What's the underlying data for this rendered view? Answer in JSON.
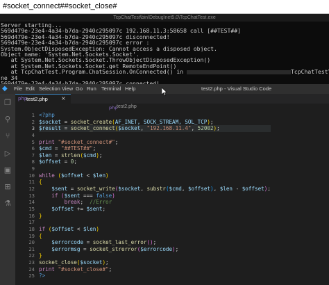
{
  "topbar": {
    "text": "#socket_connect##socket_close#"
  },
  "console": {
    "title": "TcpChatTest\\bin\\Debug\\net5.0\\TcpChatTest.exe",
    "lines": [
      "Server starting...",
      "569d479e-23e4-4a34-b7da-2940c295097c 192.168.11.3:58658 call [##TEST##]",
      "569d479e-23e4-4a34-b7da-2940c295097c disconnected!",
      "569d479e-23e4-4a34-b7da-2940c295097c error :",
      "System.ObjectDisposedException: Cannot access a disposed object.",
      "Object name: 'System.Net.Sockets.Socket'.",
      "   at System.Net.Sockets.Socket.ThrowObjectDisposedException()",
      "   at System.Net.Sockets.Socket.get_RemoteEndPoint()",
      "   at TcpChatTest.Program.ChatSession.OnConnected() in "
    ],
    "path_tail": "TcpChatTest\\Program.cs:li",
    "after_lines": [
      "ne 34",
      "569d479e-23e4-4a34-b7da-2940c295097c connected!"
    ]
  },
  "vscode": {
    "menu": [
      "File",
      "Edit",
      "Selection",
      "View",
      "Go",
      "Run",
      "Terminal",
      "Help"
    ],
    "window_title": "test2.php - Visual Studio Code",
    "tab": {
      "label": "test2.php",
      "close": "×"
    },
    "breadcrumb": "test2.php",
    "php_icon": "php",
    "line_numbers": [
      "1",
      "2",
      "3",
      "4",
      "5",
      "6",
      "7",
      "8",
      "9",
      "10",
      "11",
      "12",
      "13",
      "14",
      "15",
      "16",
      "17",
      "18",
      "19",
      "20",
      "21",
      "22",
      "23",
      "24",
      "25"
    ],
    "activity_icons": [
      "files-icon",
      "search-icon",
      "source-control-icon",
      "run-debug-icon",
      "remote-explorer-icon",
      "extensions-icon",
      "testing-icon"
    ]
  },
  "code": {
    "l1": "<?php",
    "l2_var": "$socket",
    "l2_fn": "socket_create",
    "l2_args": "AF_INET, SOCK_STREAM, SOL_TCP",
    "l3_var": "$result",
    "l3_fn": "socket_connect",
    "l3_arg1": "$socket",
    "l3_str": "\"192.168.11.4\"",
    "l3_num": "52002",
    "l5_kw": "print",
    "l5_str": "\"#socket_connect#\"",
    "l6_var": "$cmd",
    "l6_str": "\"##TEST##\"",
    "l7_var": "$len",
    "l7_fn": "strlen",
    "l7_arg": "$cmd",
    "l8_var": "$offset",
    "l8_num": "0",
    "l10_kw": "while",
    "l10_a": "$offset",
    "l10_b": "$len",
    "l11": "{",
    "l12_var": "$sent",
    "l12_fn": "socket_write",
    "l12_a": "$socket",
    "l12_fn2": "substr",
    "l12_b": "$cmd",
    "l12_c": "$offset",
    "l12_d": "$len",
    "l12_e": "$offset",
    "l13_kw": "if",
    "l13_var": "$sent",
    "l13_c": "false",
    "l14_kw": "break",
    "l14_cm": "//Error",
    "l15_var": "$offset",
    "l15_b": "$sent",
    "l16": "}",
    "l18_kw": "if",
    "l18_a": "$offset",
    "l18_b": "$len",
    "l19": "{",
    "l20_var": "$errorcode",
    "l20_fn": "socket_last_error",
    "l21_var": "$errormsg",
    "l21_fn": "socket_strerror",
    "l21_arg": "$errorcode",
    "l22": "}",
    "l23_fn": "socket_close",
    "l23_arg": "$socket",
    "l24_kw": "print",
    "l24_str": "\"#socket_close#\"",
    "l25": "?>"
  }
}
